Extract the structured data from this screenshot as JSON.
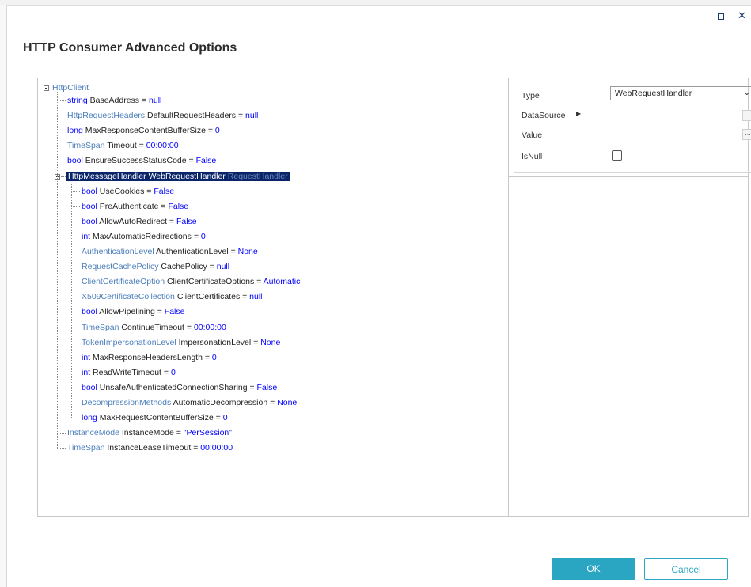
{
  "dialog": {
    "title": "HTTP Consumer Advanced Options",
    "ok_label": "OK",
    "cancel_label": "Cancel"
  },
  "tree": {
    "root": "HttpClient",
    "children": [
      {
        "type": "string",
        "name": "BaseAddress",
        "value": "null"
      },
      {
        "type": "HttpRequestHeaders",
        "name": "DefaultRequestHeaders",
        "value": "null"
      },
      {
        "type": "long",
        "name": "MaxResponseContentBufferSize",
        "value": "0"
      },
      {
        "type": "TimeSpan",
        "name": "Timeout",
        "value": "00:00:00"
      },
      {
        "type": "bool",
        "name": "EnsureSuccessStatusCode",
        "value": "False"
      }
    ],
    "handler": {
      "type": "HttpMessageHandler",
      "name": "WebRequestHandler",
      "suffix": "RequestHandler",
      "children": [
        {
          "type": "bool",
          "name": "UseCookies",
          "value": "False"
        },
        {
          "type": "bool",
          "name": "PreAuthenticate",
          "value": "False"
        },
        {
          "type": "bool",
          "name": "AllowAutoRedirect",
          "value": "False"
        },
        {
          "type": "int",
          "name": "MaxAutomaticRedirections",
          "value": "0"
        },
        {
          "type": "AuthenticationLevel",
          "name": "AuthenticationLevel",
          "value": "None"
        },
        {
          "type": "RequestCachePolicy",
          "name": "CachePolicy",
          "value": "null"
        },
        {
          "type": "ClientCertificateOption",
          "name": "ClientCertificateOptions",
          "value": "Automatic"
        },
        {
          "type": "X509CertificateCollection",
          "name": "ClientCertificates",
          "value": "null"
        },
        {
          "type": "bool",
          "name": "AllowPipelining",
          "value": "False"
        },
        {
          "type": "TimeSpan",
          "name": "ContinueTimeout",
          "value": "00:00:00"
        },
        {
          "type": "TokenImpersonationLevel",
          "name": "ImpersonationLevel",
          "value": "None"
        },
        {
          "type": "int",
          "name": "MaxResponseHeadersLength",
          "value": "0"
        },
        {
          "type": "int",
          "name": "ReadWriteTimeout",
          "value": "0"
        },
        {
          "type": "bool",
          "name": "UnsafeAuthenticatedConnectionSharing",
          "value": "False"
        },
        {
          "type": "DecompressionMethods",
          "name": "AutomaticDecompression",
          "value": "None"
        },
        {
          "type": "long",
          "name": "MaxRequestContentBufferSize",
          "value": "0"
        }
      ]
    },
    "tail": [
      {
        "type": "InstanceMode",
        "name": "InstanceMode",
        "value": "\"PerSession\""
      },
      {
        "type": "TimeSpan",
        "name": "InstanceLeaseTimeout",
        "value": "00:00:00"
      }
    ]
  },
  "properties": {
    "type_label": "Type",
    "type_value": "WebRequestHandler",
    "datasource_label": "DataSource",
    "value_label": "Value",
    "isnull_label": "IsNull",
    "ellipsis": "..."
  },
  "colors": {
    "accent": "#2aa6c3",
    "selection": "#0a246a"
  }
}
